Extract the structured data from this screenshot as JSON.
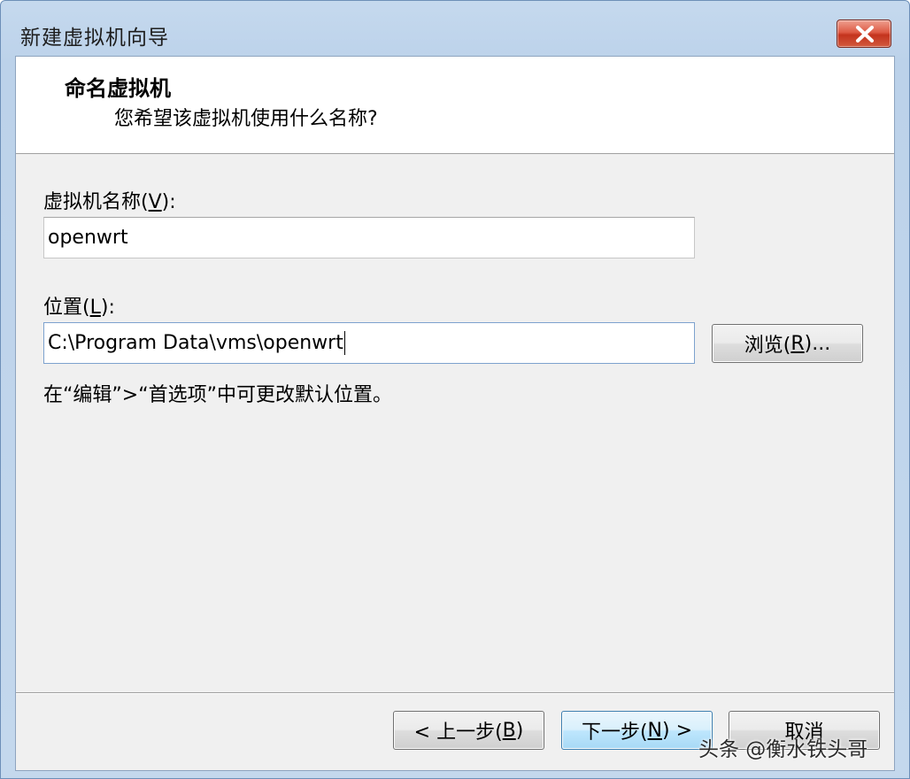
{
  "window": {
    "title": "新建虚拟机向导"
  },
  "header": {
    "title": "命名虚拟机",
    "subtitle": "您希望该虚拟机使用什么名称?"
  },
  "form": {
    "name_label_prefix": "虚拟机名称(",
    "name_label_key": "V",
    "name_label_suffix": "):",
    "name_value": "openwrt",
    "location_label_prefix": "位置(",
    "location_label_key": "L",
    "location_label_suffix": "):",
    "location_value": "C:\\Program Data\\vms\\openwrt",
    "browse_prefix": "浏览(",
    "browse_key": "R",
    "browse_suffix": ")...",
    "hint": "在“编辑”>“首选项”中可更改默认位置。"
  },
  "footer": {
    "back_prefix": "< 上一步(",
    "back_key": "B",
    "back_suffix": ")",
    "next_prefix": "下一步(",
    "next_key": "N",
    "next_suffix": ") >",
    "cancel_label": "取消"
  },
  "watermark": "头条 @衡水铁头哥",
  "icons": {
    "close": "close-icon"
  },
  "colors": {
    "title_bar": "#c5d9ee",
    "close_button": "#de5a44",
    "dialog_body": "#f0f0f0",
    "default_button": "#bee6fd"
  }
}
